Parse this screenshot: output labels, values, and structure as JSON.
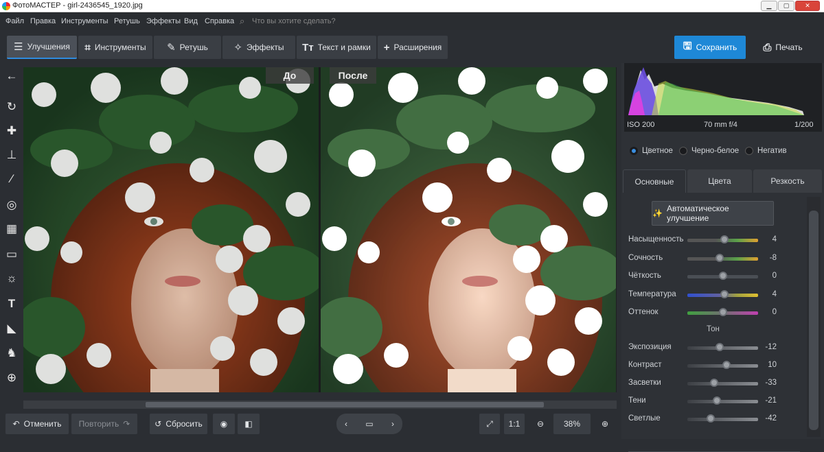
{
  "window": {
    "title": "ФотоМАСТЕР - girl-2436545_1920.jpg"
  },
  "menu": {
    "items": [
      "Файл",
      "Правка",
      "Инструменты",
      "Ретушь",
      "Эффекты",
      "Вид",
      "Справка"
    ],
    "search_placeholder": "Что вы хотите сделать?"
  },
  "toolbar": {
    "tabs": [
      "Улучшения",
      "Инструменты",
      "Ретушь",
      "Эффекты",
      "Текст и рамки",
      "Расширения"
    ],
    "save_label": "Сохранить",
    "print_label": "Печать"
  },
  "left_tools": [
    "back-arrow-icon",
    "rotate-icon",
    "healing-icon",
    "stamp-icon",
    "brush-icon",
    "radial-filter-icon",
    "gradient-filter-icon",
    "vignette-icon",
    "light-icon",
    "text-icon",
    "bucket-icon",
    "replace-bg-icon",
    "crosshair-icon"
  ],
  "compare": {
    "before_label": "До",
    "after_label": "После"
  },
  "bottom": {
    "undo_label": "Отменить",
    "redo_label": "Повторить",
    "reset_label": "Сбросить",
    "one_to_one": "1:1",
    "zoom": "38%"
  },
  "histogram": {
    "iso": "ISO 200",
    "lens": "70 mm f/4",
    "shutter": "1/200"
  },
  "color_mode": {
    "options": [
      "Цветное",
      "Черно-белое",
      "Негатив"
    ],
    "selected": "Цветное"
  },
  "panel_tabs": [
    "Основные",
    "Цвета",
    "Резкость"
  ],
  "auto_button": "Автоматическое улучшение",
  "sliders_basic": [
    {
      "label": "Насыщенность",
      "value": "4",
      "level": 0.52
    },
    {
      "label": "Сочность",
      "value": "-8",
      "level": 0.46
    },
    {
      "label": "Чёткость",
      "value": "0",
      "level": 0.5
    },
    {
      "label": "Температура",
      "value": "4",
      "level": 0.52
    },
    {
      "label": "Оттенок",
      "value": "0",
      "level": 0.5
    }
  ],
  "ton_header": "Тон",
  "sliders_tone": [
    {
      "label": "Экспозиция",
      "value": "-12",
      "level": 0.46
    },
    {
      "label": "Контраст",
      "value": "10",
      "level": 0.55
    },
    {
      "label": "Засветки",
      "value": "-33",
      "level": 0.38
    },
    {
      "label": "Тени",
      "value": "-21",
      "level": 0.42
    },
    {
      "label": "Светлые",
      "value": "-42",
      "level": 0.33
    }
  ],
  "colors": {
    "accent": "#1e88d7",
    "panel": "#2e3136"
  }
}
